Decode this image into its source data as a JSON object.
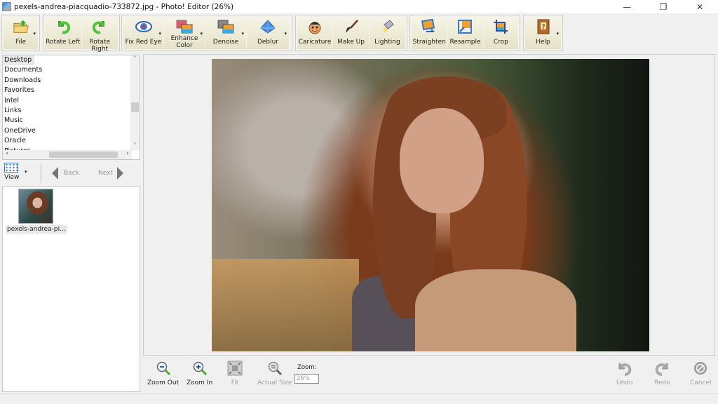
{
  "window": {
    "title": "pexels-andrea-piacquadio-733872.jpg - Photo! Editor (26%)",
    "controls": {
      "minimize": "—",
      "restore": "❐",
      "close": "✕"
    }
  },
  "toolbar": {
    "groups": [
      {
        "buttons": [
          {
            "label": "File",
            "icon": "folder-upload-icon",
            "dropdown": true
          }
        ]
      },
      {
        "buttons": [
          {
            "label": "Rotate Left",
            "icon": "rotate-left-icon"
          },
          {
            "label": "Rotate Right",
            "icon": "rotate-right-icon"
          }
        ]
      },
      {
        "buttons": [
          {
            "label": "Fix Red Eye",
            "icon": "eye-icon",
            "dropdown": true
          },
          {
            "label": "Enhance Color",
            "icon": "enhance-color-icon",
            "dropdown": true
          },
          {
            "label": "Denoise",
            "icon": "denoise-icon",
            "dropdown": true
          },
          {
            "label": "Deblur",
            "icon": "diamond-icon",
            "dropdown": true
          }
        ]
      },
      {
        "buttons": [
          {
            "label": "Caricature",
            "icon": "caricature-face-icon"
          },
          {
            "label": "Make Up",
            "icon": "makeup-brush-icon"
          },
          {
            "label": "Lighting",
            "icon": "lamp-icon"
          }
        ]
      },
      {
        "buttons": [
          {
            "label": "Straighten",
            "icon": "straighten-icon"
          },
          {
            "label": "Resample",
            "icon": "resample-icon"
          },
          {
            "label": "Crop",
            "icon": "crop-icon"
          }
        ]
      },
      {
        "buttons": [
          {
            "label": "Help",
            "icon": "help-book-icon",
            "dropdown": true
          }
        ]
      }
    ]
  },
  "sidebar": {
    "folders": [
      "Desktop",
      "Documents",
      "Downloads",
      "Favorites",
      "Intel",
      "Links",
      "Music",
      "OneDrive",
      "Oracle",
      "Pictures"
    ],
    "selected_folder": "Desktop",
    "nav": {
      "view": "View",
      "back": "Back",
      "next": "Next"
    },
    "thumbnails": [
      {
        "label": "pexels-andrea-pi..."
      }
    ]
  },
  "bottombar": {
    "zoom_out": "Zoom Out",
    "zoom_in": "Zoom In",
    "fit": "Fit",
    "actual_size": "Actual Size",
    "zoom_label": "Zoom:",
    "zoom_value": "26%",
    "undo": "Undo",
    "redo": "Redo",
    "cancel": "Cancel"
  }
}
